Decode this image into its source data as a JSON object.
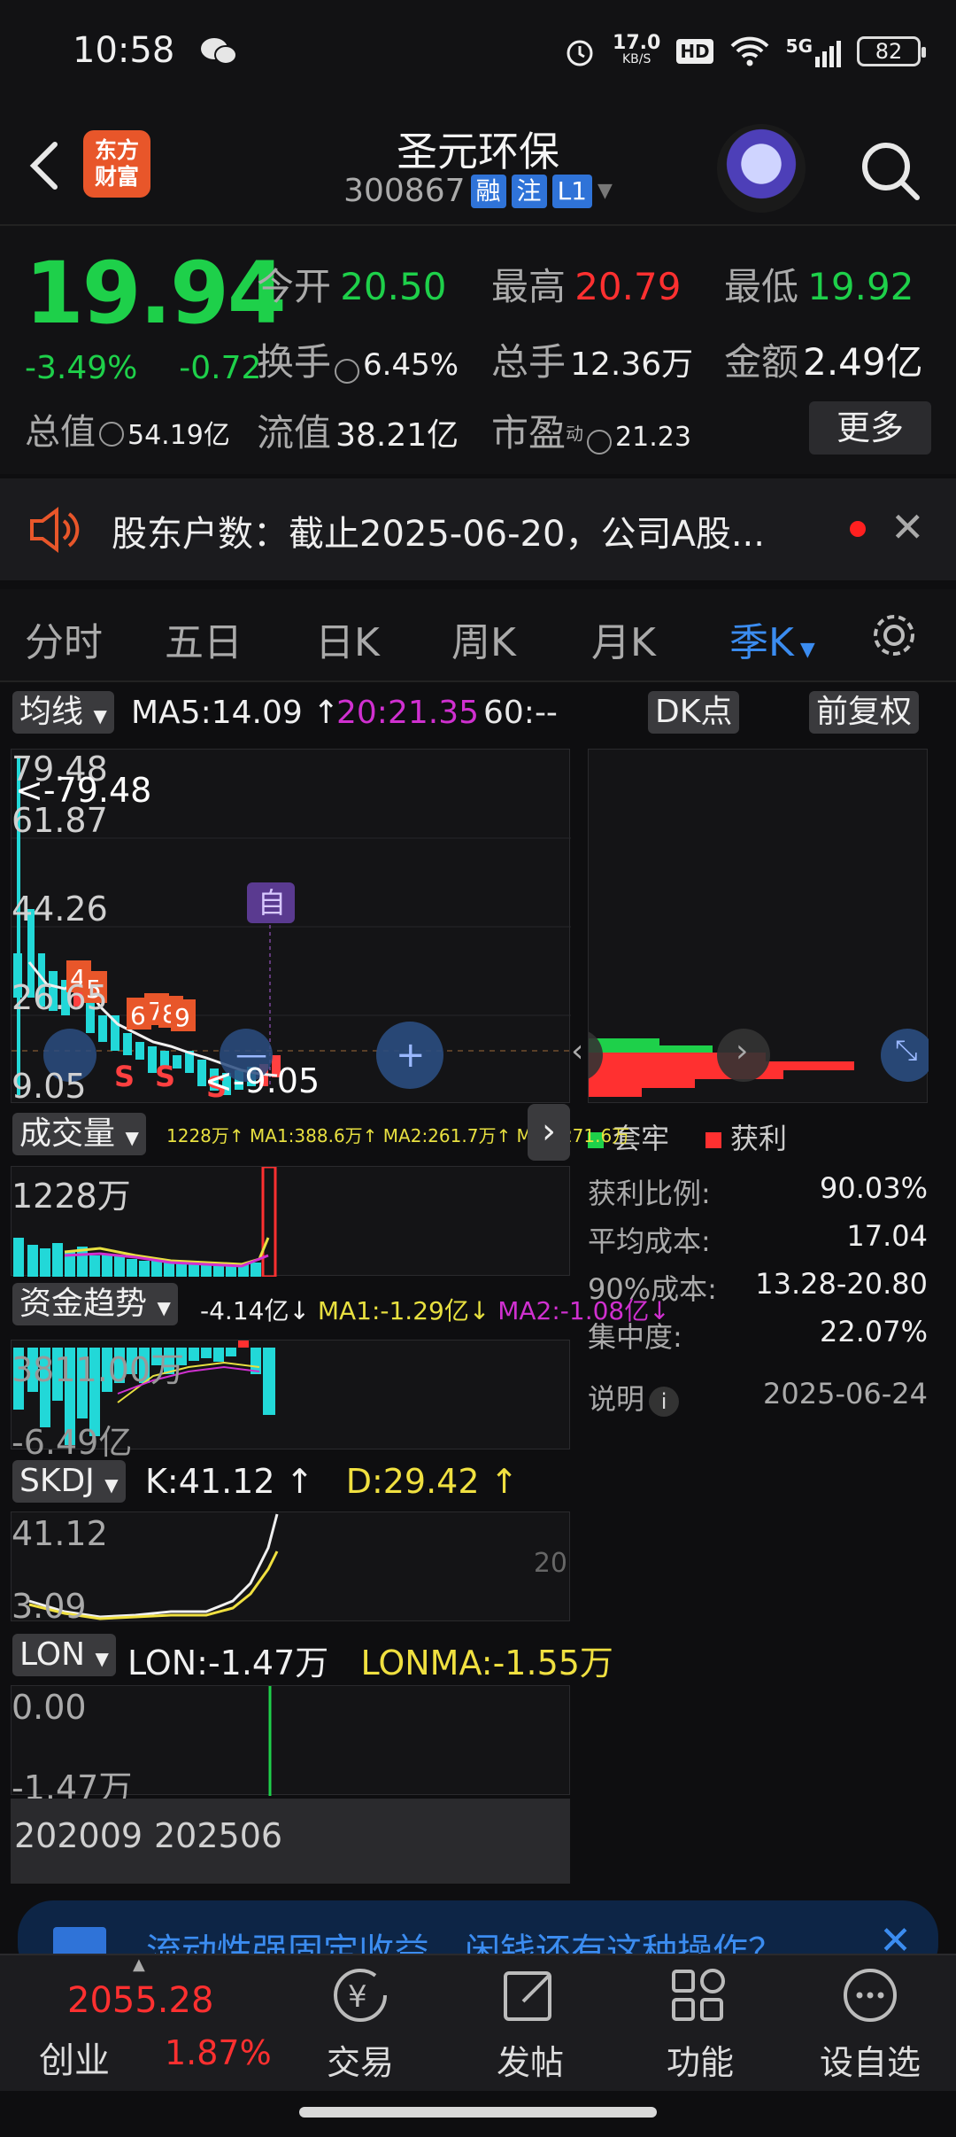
{
  "status": {
    "time": "10:58",
    "net_speed": "17.0",
    "net_unit": "KB/S",
    "hd": "HD",
    "signal": "5G",
    "battery": "82"
  },
  "header": {
    "title": "圣元环保",
    "code": "300867",
    "tag1": "融",
    "tag2": "注",
    "tag3": "L1",
    "logo": "东方\n财富"
  },
  "quote": {
    "price": "19.94",
    "change_pct": "-3.49%",
    "change": "-0.72",
    "open_label": "今开",
    "open": "20.50",
    "high_label": "最高",
    "high": "20.79",
    "low_label": "最低",
    "low": "19.92",
    "turnover_label": "换手",
    "turnover": "6.45%",
    "volume_label": "总手",
    "volume": "12.36万",
    "amount_label": "金额",
    "amount": "2.49亿",
    "mcap_label": "总值",
    "mcap": "54.19亿",
    "float_label": "流值",
    "float": "38.21亿",
    "pe_label": "市盈",
    "pe_sup": "动",
    "pe": "21.23",
    "more": "更多"
  },
  "news": {
    "text": "股东户数：截止2025-06-20，公司A股..."
  },
  "tabs": [
    "分时",
    "五日",
    "日K",
    "周K",
    "月K",
    "季K"
  ],
  "chart": {
    "ma_selector": "均线",
    "ma5": "MA5:14.09 ↑",
    "ma20": "20:21.35",
    "ma60": "60:--",
    "dk_button": "DK点",
    "fq_button": "前复权",
    "y_labels": [
      "79.48",
      "61.87",
      "44.26",
      "26.65",
      "9.05"
    ],
    "max_marker": "<-79.48",
    "min_marker": "<-9.05",
    "zi_marker": "自",
    "vol_selector": "成交量",
    "vol_line": "1228万↑ MA1:388.6万↑ MA2:261.7万↑ MA3:271.6万",
    "vol_max": "1228万",
    "fund_selector": "资金趋势",
    "fund_val": "-4.14亿↓",
    "fund_ma1": "MA1:-1.29亿↓",
    "fund_ma2": "MA2:-1.08亿↓",
    "fund_top": "3811.00万",
    "fund_bottom": "-6.49亿",
    "skdj_selector": "SKDJ",
    "skdj_k": "K:41.12 ↑",
    "skdj_d": "D:29.42 ↑",
    "skdj_top": "41.12",
    "skdj_bottom": "3.09",
    "skdj_mid": "20",
    "lon_selector": "LON",
    "lon_val": "LON:-1.47万",
    "lonma": "LONMA:-1.55万",
    "lon_top": "0.00",
    "lon_bottom": "-1.47万",
    "x_labels": [
      "202009",
      "202506"
    ]
  },
  "chip": {
    "legend_trap": "套牢",
    "legend_profit": "获利",
    "rows": [
      {
        "label": "获利比例:",
        "value": "90.03%"
      },
      {
        "label": "平均成本:",
        "value": "17.04"
      },
      {
        "label": "90%成本:",
        "value": "13.28-20.80"
      },
      {
        "label": "集中度:",
        "value": "22.07%"
      }
    ],
    "note_label": "说明",
    "date": "2025-06-24"
  },
  "ad": {
    "text": "流动性强固定收益，闲钱还有这种操作？"
  },
  "bottom_nav": {
    "index_value": "2055.28",
    "index_name": "创业",
    "index_pct": "1.87%",
    "items": [
      "交易",
      "发帖",
      "功能",
      "设自选"
    ]
  },
  "colors": {
    "up": "#ff3030",
    "down": "#1ed04a",
    "accent": "#3b8cf0",
    "bg": "#0e0e10"
  }
}
